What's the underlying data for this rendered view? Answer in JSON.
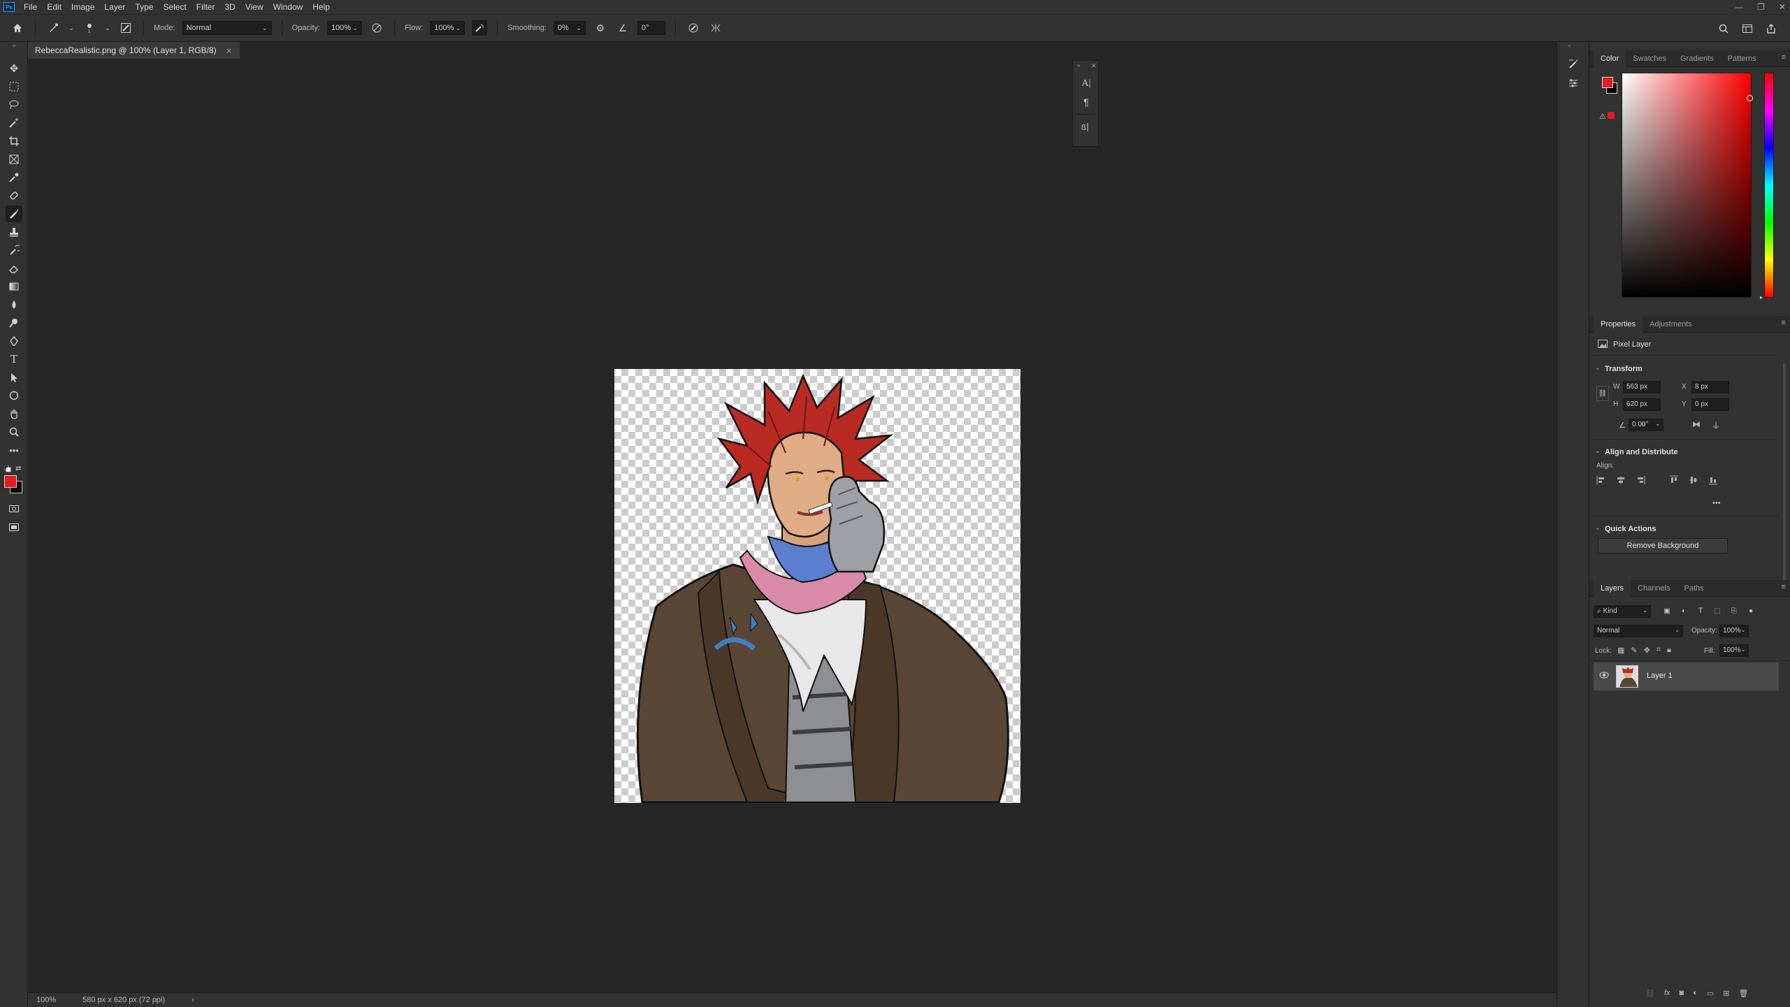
{
  "app": {
    "logo": "Ps"
  },
  "menu": [
    "File",
    "Edit",
    "Image",
    "Layer",
    "Type",
    "Select",
    "Filter",
    "3D",
    "View",
    "Window",
    "Help"
  ],
  "window_controls": [
    "—",
    "❐",
    "✕"
  ],
  "options_bar": {
    "mode_label": "Mode:",
    "mode_value": "Normal",
    "opacity_label": "Opacity:",
    "opacity_value": "100%",
    "flow_label": "Flow:",
    "flow_value": "100%",
    "smoothing_label": "Smoothing:",
    "smoothing_value": "0%",
    "angle_value": "0°"
  },
  "document_tab": {
    "title": "RebeccaRealistic.png @ 100% (Layer 1, RGB/8)",
    "close": "×"
  },
  "statusbar": {
    "zoom": "100%",
    "doc_info": "580 px x 620 px (72 ppi)",
    "arrow": "›"
  },
  "color_panel": {
    "tabs": [
      "Color",
      "Swatches",
      "Gradients",
      "Patterns"
    ],
    "foreground": "#e21c1c",
    "background": "#000000",
    "hue": "#ff0000"
  },
  "properties_panel": {
    "tabs": [
      "Properties",
      "Adjustments"
    ],
    "layer_type": "Pixel Layer",
    "transform_title": "Transform",
    "w_label": "W",
    "w_value": "563 px",
    "h_label": "H",
    "h_value": "620 px",
    "x_label": "X",
    "x_value": "8 px",
    "y_label": "Y",
    "y_value": "0 px",
    "angle_value": "0.00°",
    "align_title": "Align and Distribute",
    "align_label": "Align:",
    "more": "•••",
    "quick_title": "Quick Actions",
    "remove_bg": "Remove Background"
  },
  "layers_panel": {
    "tabs": [
      "Layers",
      "Channels",
      "Paths"
    ],
    "kind_value": "Kind",
    "blend_value": "Normal",
    "opacity_label": "Opacity:",
    "opacity_value": "100%",
    "lock_label": "Lock:",
    "fill_label": "Fill:",
    "fill_value": "100%",
    "layer_name": "Layer 1"
  }
}
